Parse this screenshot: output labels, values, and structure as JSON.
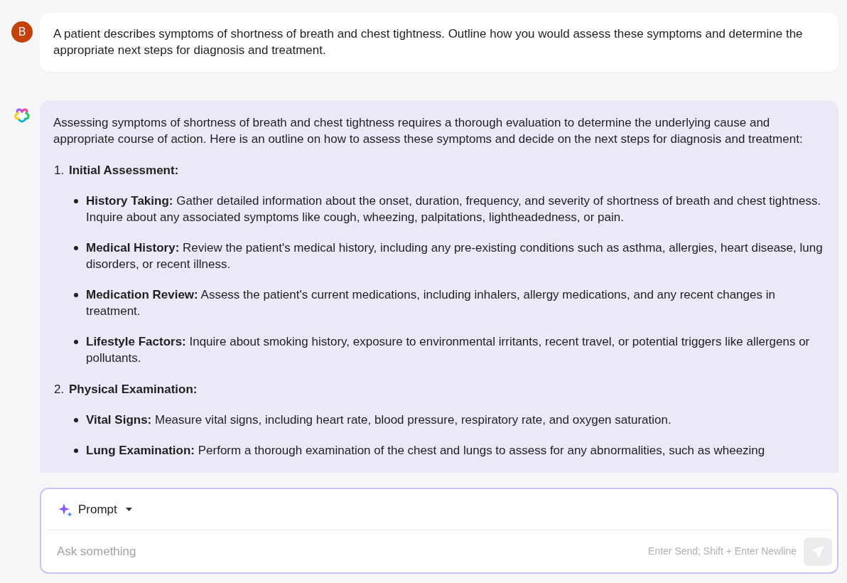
{
  "user_message": {
    "avatar": "B",
    "text": "A patient describes symptoms of shortness of breath and chest tightness. Outline how you would assess these symptoms and determine the appropriate next steps for diagnosis and treatment."
  },
  "response": {
    "intro": "Assessing symptoms of shortness of breath and chest tightness requires a thorough evaluation to determine the underlying cause and appropriate course of action. Here is an outline on how to assess these symptoms and decide on the next steps for diagnosis and treatment:",
    "sections": [
      {
        "number": "1.",
        "title": "Initial Assessment:",
        "items": [
          "**History Taking:** Gather detailed information about the onset, duration, frequency, and severity of shortness of breath and chest tightness. Inquire about any associated symptoms like cough, wheezing, palpitations, lightheadedness, or pain.",
          "**Medical History:** Review the patient's medical history, including any pre-existing conditions such as asthma, allergies, heart disease, lung disorders, or recent illness.",
          "**Medication Review:** Assess the patient's current medications, including inhalers, allergy medications, and any recent changes in treatment.",
          "**Lifestyle Factors:** Inquire about smoking history, exposure to environmental irritants, recent travel, or potential triggers like allergens or pollutants."
        ]
      },
      {
        "number": "2.",
        "title": "Physical Examination:",
        "items": [
          "**Vital Signs:** Measure vital signs, including heart rate, blood pressure, respiratory rate, and oxygen saturation.",
          "**Lung Examination:** Perform a thorough examination of the chest and lungs to assess for any abnormalities, such as wheezing"
        ]
      }
    ]
  },
  "composer": {
    "mode": "Prompt",
    "placeholder": "Ask something",
    "hint": "Enter Send; Shift + Enter Newline"
  }
}
